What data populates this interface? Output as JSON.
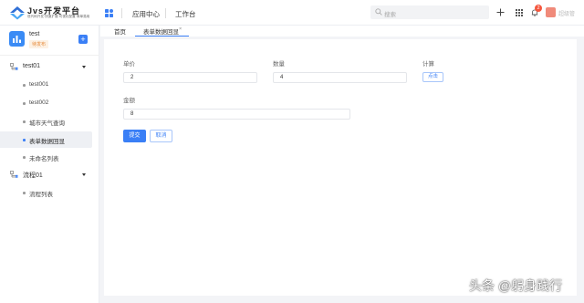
{
  "header": {
    "brand_title": "Jvs开发平台",
    "brand_subtitle": "低代码开发·快速扩展·可视化配置·简单易用",
    "nav": [
      "应用中心",
      "工作台"
    ],
    "search_placeholder": "搜索",
    "notification_count": "2",
    "user_name": "超级管"
  },
  "sidebar": {
    "app_name": "test",
    "app_status": "待发布",
    "add_label": "+",
    "groups": [
      {
        "label": "test01",
        "items": [
          "test001",
          "test002",
          "城市天气查询",
          "表单数据回显",
          "未命名列表"
        ]
      },
      {
        "label": "流程01",
        "items": [
          "流程列表"
        ]
      }
    ],
    "active_item": "表单数据回显"
  },
  "tabs": [
    {
      "label": "首页"
    },
    {
      "label": "表单数据回显",
      "close": "×"
    }
  ],
  "form": {
    "unit_price_label": "单价",
    "unit_price_value": "2",
    "quantity_label": "数量",
    "quantity_value": "4",
    "calc_label": "计算",
    "calc_button": "点击",
    "amount_label": "金额",
    "amount_value": "8",
    "submit_button": "提交",
    "cancel_button": "取消"
  },
  "watermark": "头条 @躬身践行",
  "colors": {
    "accent": "#3a7ff6",
    "badge": "#f5563d",
    "status_tag": "#e68a3a"
  }
}
